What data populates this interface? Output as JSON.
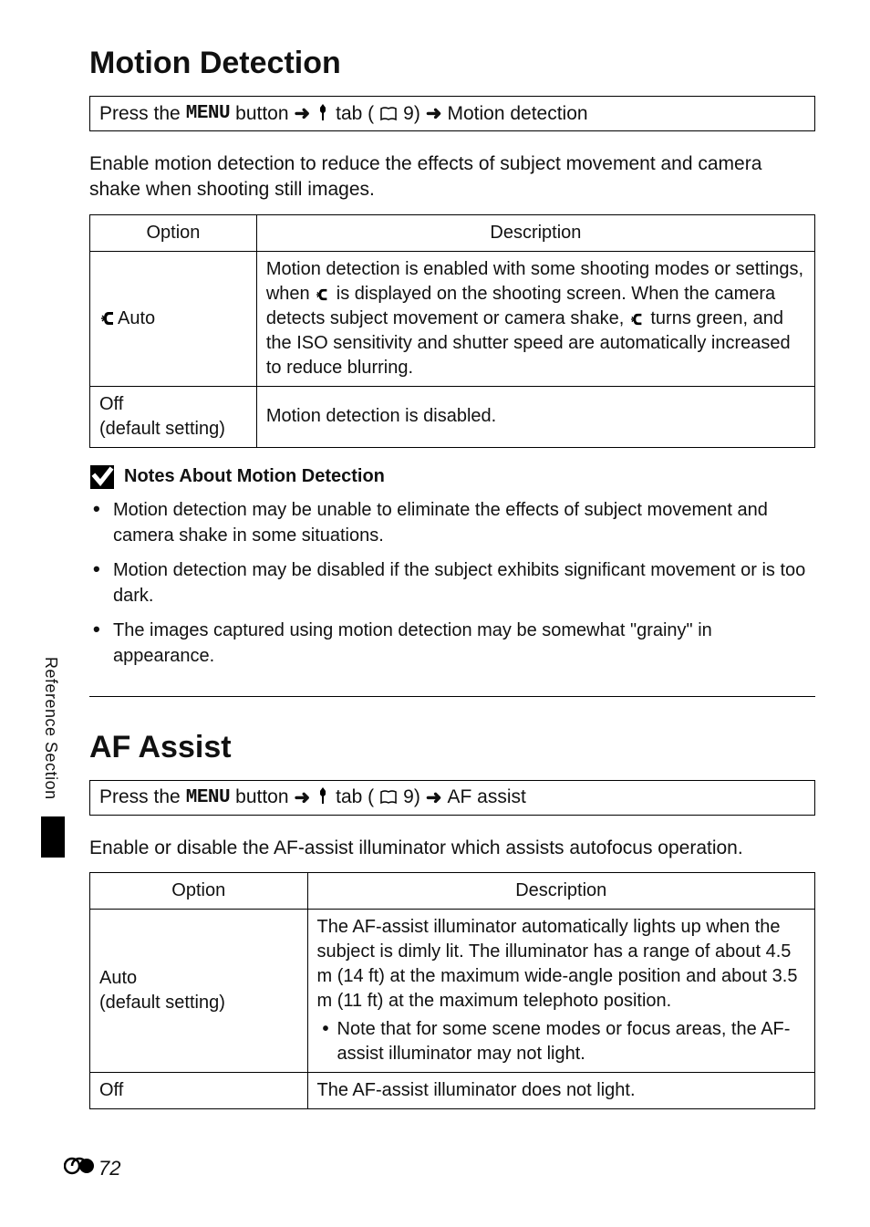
{
  "side_tab_label": "Reference Section",
  "page_number": "72",
  "section1": {
    "title": "Motion Detection",
    "nav": {
      "prefix": "Press the",
      "menu_word": "MENU",
      "button_word": "button",
      "tab_word": "tab (",
      "page_ref": "9)",
      "dest": "Motion detection"
    },
    "intro": "Enable motion detection to reduce the effects of subject movement and camera shake when shooting still images.",
    "table": {
      "h_option": "Option",
      "h_desc": "Description",
      "rows": [
        {
          "option_icon": "motion-icon",
          "option_label": "Auto",
          "desc_pre": "Motion detection is enabled with some shooting modes or settings, when ",
          "desc_mid": " is displayed on the shooting screen. When the camera detects subject movement or camera shake, ",
          "desc_post": " turns green, and the ISO sensitivity and shutter speed are automatically increased to reduce blurring."
        },
        {
          "option_label_line1": "Off",
          "option_label_line2": "(default setting)",
          "desc": "Motion detection is disabled."
        }
      ]
    },
    "notes_title": "Notes About Motion Detection",
    "notes": [
      "Motion detection may be unable to eliminate the effects of subject movement and camera shake in some situations.",
      "Motion detection may be disabled if the subject exhibits significant movement or is too dark.",
      "The images captured using motion detection may be somewhat \"grainy\" in appearance."
    ]
  },
  "section2": {
    "title": "AF Assist",
    "nav": {
      "prefix": "Press the",
      "menu_word": "MENU",
      "button_word": "button",
      "tab_word": "tab (",
      "page_ref": "9)",
      "dest": "AF assist"
    },
    "intro": "Enable or disable the AF-assist illuminator which assists autofocus operation.",
    "table": {
      "h_option": "Option",
      "h_desc": "Description",
      "rows": [
        {
          "option_label_line1": "Auto",
          "option_label_line2": "(default setting)",
          "desc_main": "The AF-assist illuminator automatically lights up when the subject is dimly lit. The illuminator has a range of about 4.5 m (14 ft) at the maximum wide-angle position and about 3.5 m (11 ft) at the maximum telephoto position.",
          "desc_bullet": "Note that for some scene modes or focus areas, the AF-assist illuminator may not light."
        },
        {
          "option_label": "Off",
          "desc": "The AF-assist illuminator does not light."
        }
      ]
    }
  }
}
